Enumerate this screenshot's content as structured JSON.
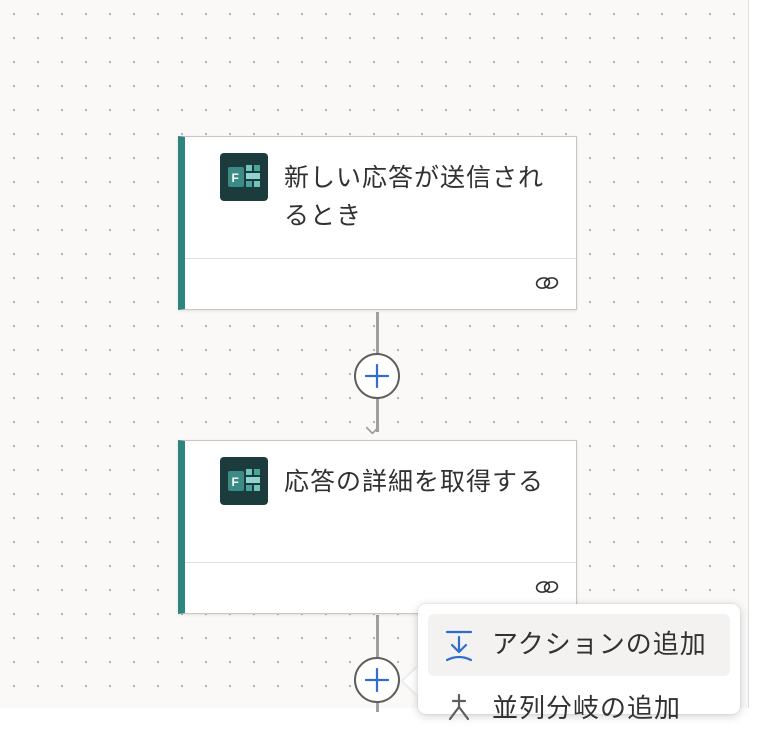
{
  "flow": {
    "steps": [
      {
        "title": "新しい応答が送信されるとき",
        "icon": "microsoft-forms-icon",
        "footer_icon": "link-icon"
      },
      {
        "title": "応答の詳細を取得する",
        "icon": "microsoft-forms-icon",
        "footer_icon": "link-icon"
      }
    ]
  },
  "add_menu": {
    "items": [
      {
        "label": "アクションの追加",
        "icon": "add-action-icon",
        "selected": true
      },
      {
        "label": "並列分岐の追加",
        "icon": "add-parallel-branch-icon",
        "selected": false
      }
    ]
  },
  "colors": {
    "card_accent": "#2e8580",
    "forms_icon_bg": "#1c3b3d",
    "plus_blue": "#2f6ed1",
    "connector": "#a19f9d",
    "canvas_bg": "#faf9f8"
  }
}
